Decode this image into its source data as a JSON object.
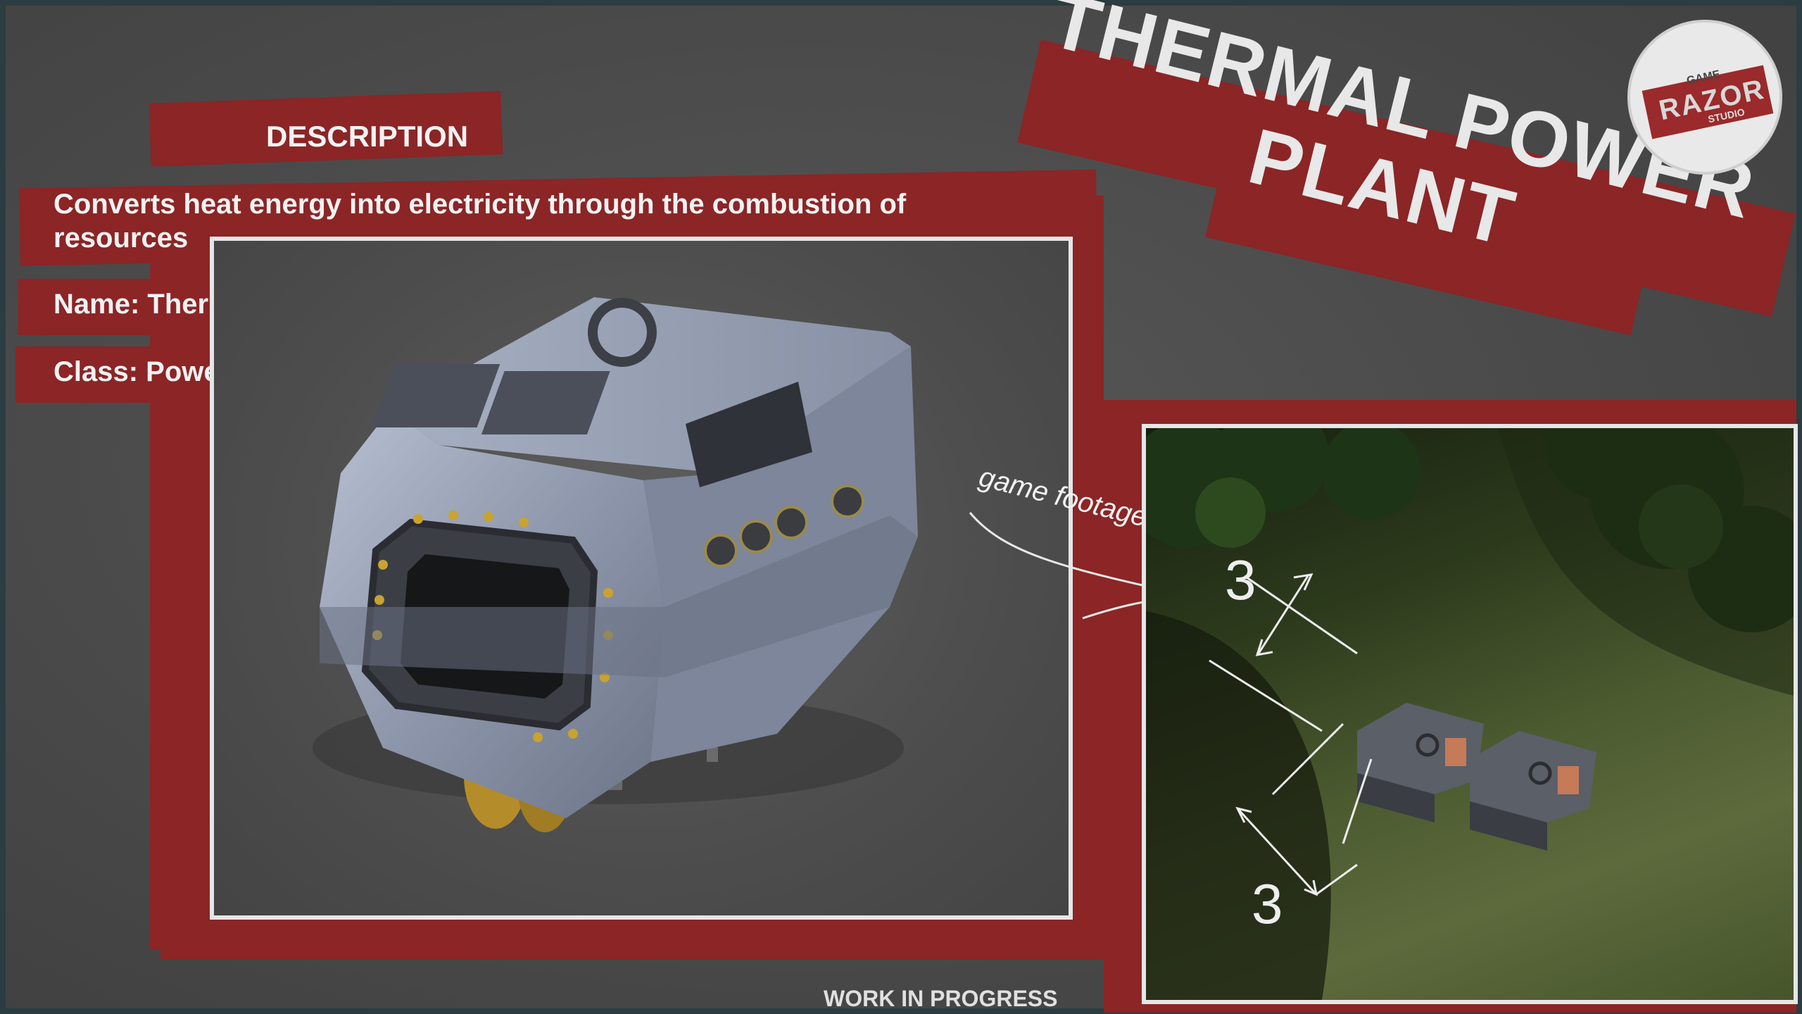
{
  "description": {
    "heading": "DESCRIPTION",
    "body": "Converts heat energy into electricity through the combustion of resources",
    "name_line": "Name: Thermal Power Plant",
    "class_line": "Class: Power"
  },
  "title": {
    "line1": "THERMAL POWER",
    "line2": "PLANT"
  },
  "footage": {
    "label": "game footage",
    "dimension_top": "3",
    "dimension_bottom": "3"
  },
  "logo": {
    "word": "RAZOR",
    "top_text": "GAME",
    "bottom_text": "STUDIO"
  },
  "footer": {
    "status": "WORK IN PROGRESS"
  },
  "colors": {
    "brush_red": "#8b2526",
    "frame": "#e6e6e6",
    "background": "#4a4a4a"
  }
}
